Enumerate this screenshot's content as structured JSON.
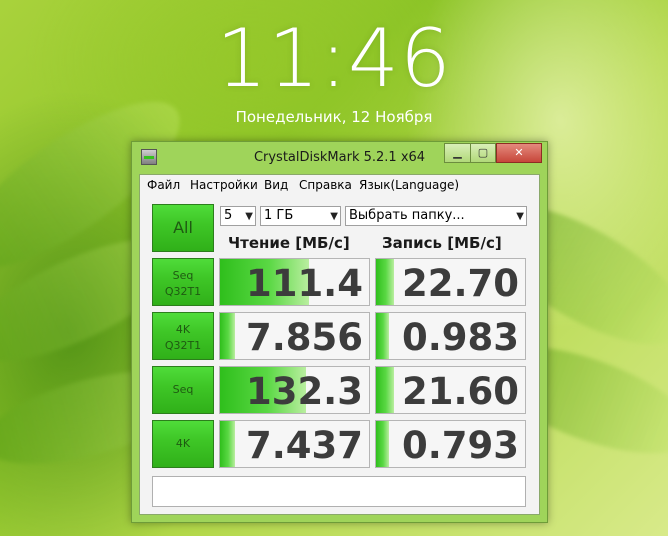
{
  "lockscreen": {
    "time": "11:46",
    "date": "Понедельник, 12 Ноября"
  },
  "window": {
    "title": "CrystalDiskMark 5.2.1 x64",
    "min_glyph": "▁",
    "max_glyph": "▢",
    "close_glyph": "✕"
  },
  "menu": {
    "items": [
      "Файл",
      "Настройки",
      "Вид",
      "Справка",
      "Язык(Language)"
    ]
  },
  "controls": {
    "all_label": "All",
    "count_value": "5",
    "size_value": "1 ГБ",
    "folder_value": "Выбрать папку...",
    "arrow_glyph": "▼"
  },
  "columns": {
    "read": "Чтение [МБ/с]",
    "write": "Запись [МБ/с]"
  },
  "tests": [
    {
      "line1": "Seq",
      "line2": "Q32T1",
      "read": "111.4",
      "write": "22.70",
      "read_fill": 0.6,
      "write_fill": 0.12
    },
    {
      "line1": "4K",
      "line2": "Q32T1",
      "read": "7.856",
      "write": "0.983",
      "read_fill": 0.1,
      "write_fill": 0.09
    },
    {
      "line1": "Seq",
      "line2": "",
      "read": "132.3",
      "write": "21.60",
      "read_fill": 0.58,
      "write_fill": 0.12
    },
    {
      "line1": "4K",
      "line2": "",
      "read": "7.437",
      "write": "0.793",
      "read_fill": 0.1,
      "write_fill": 0.09
    }
  ],
  "status": "",
  "colors": {
    "button_green": "#3fc727",
    "bar_green": "#2fbf1c",
    "window_frame": "#9fd45a",
    "close_red": "#c7463a"
  }
}
